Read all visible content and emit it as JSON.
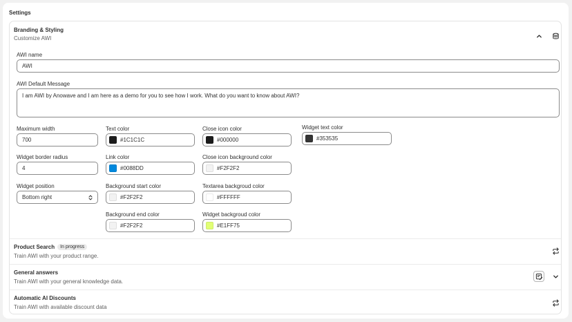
{
  "page": {
    "title": "Settings"
  },
  "branding": {
    "title": "Branding & Styling",
    "subtitle": "Customize AWI",
    "awi_name_label": "AWI name",
    "awi_name_value": "AWI",
    "default_message_label": "AWI Default Message",
    "default_message_value": "I am AWI by Anowave and I am here as a demo for you to see how I work. What do you want to know about AWI?",
    "max_width_label": "Maximum width",
    "max_width_value": "700",
    "border_radius_label": "Widget border radius",
    "border_radius_value": "4",
    "position_label": "Widget position",
    "position_value": "Bottom right",
    "colors": {
      "text_color": {
        "label": "Text color",
        "value": "#1C1C1C",
        "swatch": "#1C1C1C"
      },
      "link_color": {
        "label": "Link color",
        "value": "#0088DD",
        "swatch": "#0088DD"
      },
      "bg_start": {
        "label": "Background start color",
        "value": "#F2F2F2",
        "swatch": "#F2F2F2"
      },
      "bg_end": {
        "label": "Background end color",
        "value": "#F2F2F2",
        "swatch": "#F2F2F2"
      },
      "close_icon": {
        "label": "Close icon color",
        "value": "#000000",
        "swatch": "#1C1C1C"
      },
      "close_icon_bg": {
        "label": "Close icon background color",
        "value": "#F2F2F2",
        "swatch": "#F2F2F2"
      },
      "textarea_bg": {
        "label": "Textarea backgroud color",
        "value": "#FFFFFF",
        "swatch": "#FFFFFF"
      },
      "widget_bg": {
        "label": "Widget backgroud color",
        "value": "#E1FF75",
        "swatch": "#E1FF75"
      },
      "widget_text": {
        "label": "Widget text color",
        "value": "#353535",
        "swatch": "#353535"
      }
    }
  },
  "product_search": {
    "title": "Product Search",
    "badge": "In progress",
    "subtitle": "Train AWI with your product range."
  },
  "general_answers": {
    "title": "General answers",
    "subtitle": "Train AWI with your general knowledge data."
  },
  "ai_discounts": {
    "title": "Automatic AI Discounts",
    "subtitle": "Train AWI with available discount data"
  }
}
